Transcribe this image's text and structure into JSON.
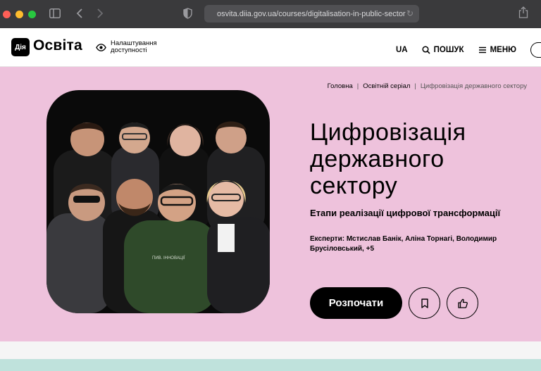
{
  "browser": {
    "url": "osvita.diia.gov.ua/courses/digitalisation-in-public-sector"
  },
  "header": {
    "logo_badge": "Дія",
    "logo_text": "Освіта",
    "accessibility_label": "Налаштування доступності",
    "nav": {
      "language": "UA",
      "search": "ПОШУК",
      "menu": "МЕНЮ"
    }
  },
  "breadcrumb": {
    "home": "Головна",
    "section": "Освітній серіал",
    "current": "Цифровізація державного сектору"
  },
  "hero": {
    "title": "Цифровізація державного сектору",
    "subtitle": "Етапи реалізації цифрової трансформації",
    "experts": "Експерти: Мстислав Банік, Аліна Торнагі, Володимир Брусіловський, +5",
    "start_label": "Розпочати",
    "background_color": "#eec2dc"
  }
}
